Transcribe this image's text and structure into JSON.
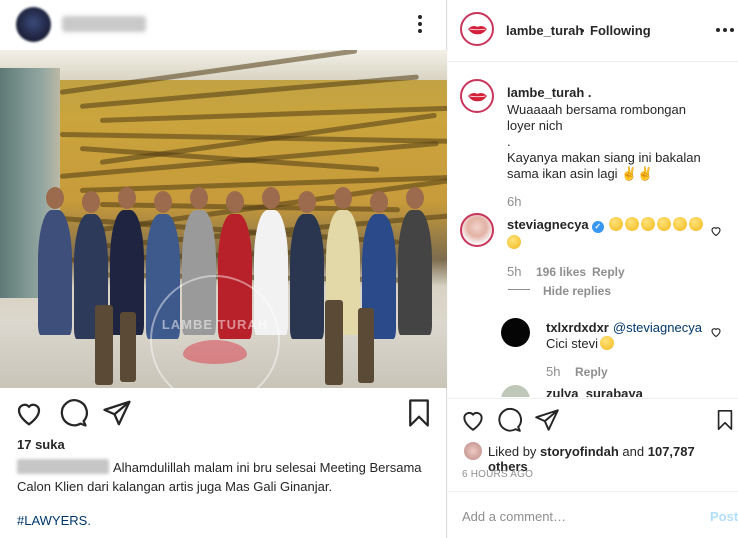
{
  "left": {
    "likes": "17 suka",
    "caption": "Alhamdulillah malam ini bru selesai Meeting Bersama Calon Klien dari kalangan artis juga Mas Gali Ginanjar.",
    "hashtag": "#LAWYERS.",
    "watermark": "LAMBE TURAH"
  },
  "right": {
    "header": {
      "username": "lambe_turah",
      "dot": "•",
      "follow_label": "Following"
    },
    "caption_comment": {
      "username": "lambe_turah .",
      "text": "Wuaaaah bersama rombongan loyer nich\n.\nKayanya makan siang ini bakalan sama ikan asin lagi ✌✌",
      "time": "6h"
    },
    "comments": [
      {
        "username": "stevi​agnecya",
        "time": "5h",
        "likes": "196 likes",
        "reply_label": "Reply"
      },
      {
        "username": "txlxrdxdxr",
        "mention": "@steviagnecya",
        "text": "Cici stevi",
        "time": "5h",
        "reply_label": "Reply"
      },
      {
        "username": "zulya_surabaya"
      }
    ],
    "hide_replies": "Hide replies",
    "liked_by": {
      "prefix": "Liked by",
      "user": "storyofindah",
      "and": "and",
      "others": "107,787 others"
    },
    "post_time": "6 HOURS AGO",
    "comment_input": {
      "placeholder": "Add a comment…"
    },
    "post_label": "Post"
  },
  "colors": {
    "link": "#00376b",
    "muted": "#8e8e8e",
    "brand_red": "#c9355a",
    "verified": "#3897f0",
    "post_disabled": "#b2dffc"
  }
}
